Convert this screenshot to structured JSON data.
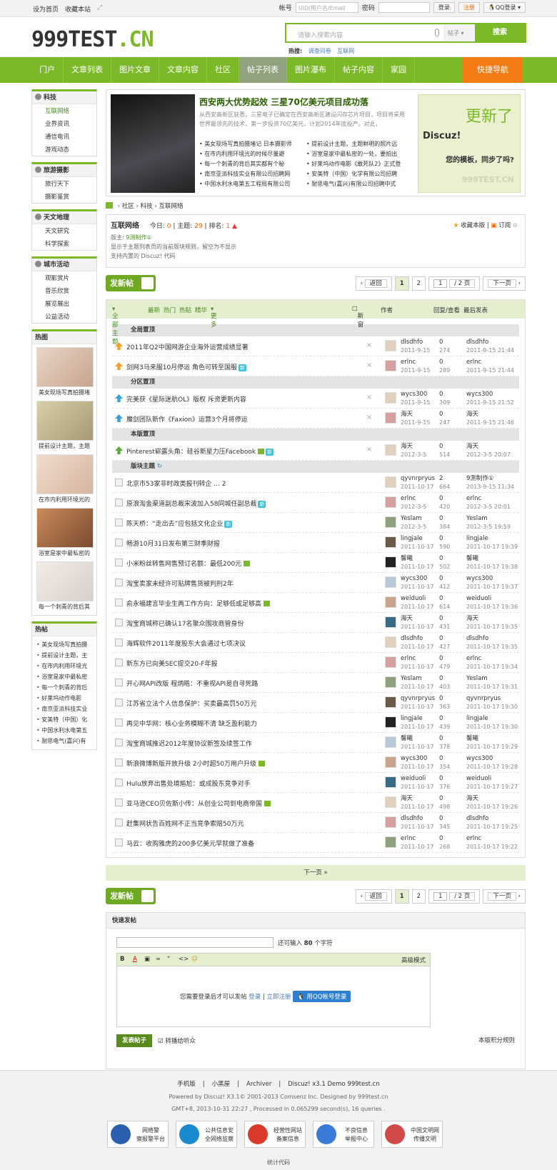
{
  "topbar": {
    "left": [
      "设为首页",
      "收藏本站"
    ],
    "account_label": "帐号",
    "account_placeholder": "UID/用户名/Email",
    "pwd_label": "密码",
    "login": "登录",
    "register": "注册",
    "qq": "QQ登录"
  },
  "header": {
    "logo_main": "999TEST",
    "logo_cn": ".CN",
    "search_placeholder": "请输入搜索内容",
    "search_type": "帖子",
    "search_btn": "搜索",
    "hot_label": "热搜:",
    "hot_items": [
      "调查问卷",
      "互联网"
    ]
  },
  "nav": {
    "items": [
      "门户",
      "文章列表",
      "图片文章",
      "文章内容",
      "社区",
      "帖子列表",
      "图片瀑布",
      "帖子内容",
      "家园"
    ],
    "active": "帖子列表",
    "quick": "快捷导航"
  },
  "sidebar": {
    "groups": [
      {
        "title": "科技",
        "items": [
          "互联网络",
          "业界资讯",
          "通信电讯",
          "游戏动态"
        ]
      },
      {
        "title": "旅游摄影",
        "items": [
          "旅行天下",
          "摄影鉴赏"
        ]
      },
      {
        "title": "天文地理",
        "items": [
          "天文研究",
          "科学探索"
        ]
      },
      {
        "title": "城市活动",
        "items": [
          "观影赏片",
          "音乐欣赏",
          "展览展出",
          "公益活动"
        ]
      }
    ],
    "hotpic_title": "热图",
    "hotpics": [
      "美女现场写真拍摄堵",
      "提前设计主题，主题",
      "在市内利用环境光的",
      "浴室是家中最私密的",
      "每一个刺青的背后其"
    ],
    "hotpost_title": "热帖",
    "hotposts": [
      "美女现场写真拍摄",
      "提前设计主题，主",
      "在市内利用环境光",
      "浴室是家中最私密",
      "每一个刺青的背后",
      "好莱坞动作电影",
      "南京亚派科技实业",
      "安美特（中国）化",
      "中国水利水电第五",
      "耐思电气(嘉兴)有"
    ]
  },
  "feature": {
    "title": "西安两大优势起效 三星70亿美元项目成功落",
    "desc": "从西安高新区获悉，三星电子已确定在西安高新区建设闪存芯片项目，项目将采用世界最领先的技术，第一步投资70亿美元，计划2014年底投产。对此，",
    "links": [
      "美女现场写真拍摄堵记 日本摄影师",
      "提前设计主题，主题鲜明的照片远",
      "在市内利用环境光的时候尽量避",
      "浴室是家中最私密的一处，要拍出",
      "每一个刺青的背后其实都有个秘",
      "好莱坞动作电影《敢死队2》正式登",
      "南京亚派科技实业有限公司招聘网",
      "安美特（中国）化学有限公司招聘",
      "中国水利水电第五工程局有限公司",
      "耐思电气(嘉兴)有限公司招聘中式"
    ],
    "ad1": "更新了",
    "ad2": "Discuz!",
    "ad3": "您的模板，同步了吗?",
    "ad4": "999TEST.CN"
  },
  "breadcrumb": [
    "社区",
    "科技",
    "互联网络"
  ],
  "forum": {
    "name": "互联网络",
    "today_label": "今日:",
    "today": "0",
    "topics_label": "主题:",
    "topics": "29",
    "rank_label": "排名:",
    "rank": "1",
    "fav": "收藏本版",
    "rss": "订阅",
    "mod_label": "版主:",
    "mod": "9测制作①",
    "rule1": "显示于主题列表页的当前版块规则，留空为不显示",
    "rule2": "支持内置的 Discuz! 代码"
  },
  "pager": {
    "post": "发新帖",
    "back": "返回",
    "p1": "1",
    "p2": "2",
    "cur": "1",
    "total": "/ 2 页",
    "next": "下一页"
  },
  "listhead": {
    "all": "全部主题",
    "latest": "最新",
    "hot": "热门",
    "hotpost": "热贴",
    "digest": "精华",
    "more": "更多",
    "newwin": "新窗",
    "author": "作者",
    "reply": "回复/查看",
    "last": "最后发表"
  },
  "sections": {
    "global": "全局置顶",
    "cat": "分区置顶",
    "forum": "本版置顶",
    "topics": "版块主题"
  },
  "global_rows": [
    {
      "title": "2011年Q2中国网游企业海外运营成绩显著",
      "author": "dlsdhfo",
      "date": "2011-9-15",
      "r": "0",
      "v": "274",
      "lu": "dlsdhfo",
      "ld": "2011-9-15 21:44",
      "new": false
    },
    {
      "title": "剑网3马来服10月停运 角色可转至国服",
      "author": "erlnc",
      "date": "2011-9-15",
      "r": "0",
      "v": "289",
      "lu": "erlnc",
      "ld": "2011-9-15 21:44",
      "new": true
    }
  ],
  "cat_rows": [
    {
      "title": "完美获《星际迷航OL》版权 斥资更新内容",
      "author": "wycs300",
      "date": "2011-9-15",
      "r": "0",
      "v": "309",
      "lu": "wycs300",
      "ld": "2011-9-15 21:52",
      "new": false
    },
    {
      "title": "魔剑团队新作《Faxion》运营3个月将停运",
      "author": "海天",
      "date": "2011-9-15",
      "r": "0",
      "v": "247",
      "lu": "海天",
      "ld": "2011-9-15 21:46",
      "new": false
    }
  ],
  "forum_rows": [
    {
      "title": "Pinterest崭露头角：硅谷新星力压Facebook",
      "author": "海天",
      "date": "2012-3-5",
      "r": "0",
      "v": "514",
      "lu": "海天",
      "ld": "2012-3-5 20:07",
      "new": true,
      "img": true
    }
  ],
  "rows": [
    {
      "title": "北京市53家非时政类报刊转企",
      "suffix": " ... 2",
      "author": "qyvnrpryus",
      "date": "2011-10-17",
      "r": "2",
      "v": "664",
      "lu": "9测制作①",
      "ld": "2013-9-15 11:34"
    },
    {
      "title": "原浪淘金渠道副总裁宋波加入58同城任副总裁",
      "author": "erlnc",
      "date": "2012-3-5",
      "r": "0",
      "v": "420",
      "lu": "erlnc",
      "ld": "2012-3-5 20:01",
      "new": true
    },
    {
      "title": "陈天桥：“走出去”应包括文化企业",
      "author": "Yeslam",
      "date": "2012-3-5",
      "r": "0",
      "v": "384",
      "lu": "Yeslam",
      "ld": "2012-3-5 19:59",
      "new": true
    },
    {
      "title": "畅游10月31日发布第三财季财报",
      "author": "lingjale",
      "date": "2011-10-17",
      "r": "0",
      "v": "590",
      "lu": "lingjale",
      "ld": "2011-10-17 19:39"
    },
    {
      "title": "小米粉丝转售网售预订名额：最低200元",
      "author": "馨曦",
      "date": "2011-10-17",
      "r": "0",
      "v": "502",
      "lu": "馨曦",
      "ld": "2011-10-17 19:38",
      "img": true
    },
    {
      "title": "淘宝卖家未经许可贴牌售货被判刑2年",
      "author": "wycs300",
      "date": "2011-10-17",
      "r": "0",
      "v": "412",
      "lu": "wycs300",
      "ld": "2011-10-17 19:37"
    },
    {
      "title": "俞永福建言毕业生两工作方向：足够低或足够高",
      "author": "weiduoli",
      "date": "2011-10-17",
      "r": "0",
      "v": "614",
      "lu": "weiduoli",
      "ld": "2011-10-17 19:36",
      "img": true
    },
    {
      "title": "淘宝商城称已确认17名聚众围攻商管身份",
      "author": "海天",
      "date": "2011-10-17",
      "r": "0",
      "v": "431",
      "lu": "海天",
      "ld": "2011-10-17 19:35"
    },
    {
      "title": "海辉软件2011年度股东大会通过七项决议",
      "author": "dlsdhfo",
      "date": "2011-10-17",
      "r": "0",
      "v": "427",
      "lu": "dlsdhfo",
      "ld": "2011-10-17 19:35"
    },
    {
      "title": "新东方已向美SEC提交20-F年报",
      "author": "erlnc",
      "date": "2011-10-17",
      "r": "0",
      "v": "479",
      "lu": "erlnc",
      "ld": "2011-10-17 19:34"
    },
    {
      "title": "开心网API改版 程炳皓：不重视API是自寻死路",
      "author": "Yeslam",
      "date": "2011-10-17",
      "r": "0",
      "v": "403",
      "lu": "Yeslam",
      "ld": "2011-10-17 19:31"
    },
    {
      "title": "江苏省立法个人信息保护：买卖最高罚50万元",
      "author": "qyvnrpryus",
      "date": "2011-10-17",
      "r": "0",
      "v": "363",
      "lu": "qyvnrpryus",
      "ld": "2011-10-17 19:30"
    },
    {
      "title": "再见中华网：核心业务模糊不清 缺乏盈利能力",
      "author": "lingjale",
      "date": "2011-10-17",
      "r": "0",
      "v": "439",
      "lu": "lingjale",
      "ld": "2011-10-17 19:30"
    },
    {
      "title": "淘宝商城推迟2012年度协议新签及续签工作",
      "author": "馨曦",
      "date": "2011-10-17",
      "r": "0",
      "v": "378",
      "lu": "馨曦",
      "ld": "2011-10-17 19:29"
    },
    {
      "title": "新浪微博新版开放升级 2小时超50万用户升级",
      "author": "wycs300",
      "date": "2011-10-17",
      "r": "0",
      "v": "354",
      "lu": "wycs300",
      "ld": "2011-10-17 19:28",
      "img": true
    },
    {
      "title": "Hulu放弃出售处境尴尬：或成股东竞争对手",
      "author": "weiduoli",
      "date": "2011-10-17",
      "r": "0",
      "v": "376",
      "lu": "weiduoli",
      "ld": "2011-10-17 19:27"
    },
    {
      "title": "亚马逊CEO贝佐斯小传：从创业公司到电商帝国",
      "author": "海天",
      "date": "2011-10-17",
      "r": "0",
      "v": "498",
      "lu": "海天",
      "ld": "2011-10-17 19:26",
      "img": true
    },
    {
      "title": "赶集网状告百姓网不正当竞争索赔50万元",
      "author": "dlsdhfo",
      "date": "2011-10-17",
      "r": "0",
      "v": "345",
      "lu": "dlsdhfo",
      "ld": "2011-10-17 19:25"
    },
    {
      "title": "马云：收购雅虎的200多亿美元早就做了准备",
      "author": "erlnc",
      "date": "2011-10-17",
      "r": "0",
      "v": "268",
      "lu": "erlnc",
      "ld": "2011-10-17 19:22"
    }
  ],
  "next_page": "下一页 »",
  "quickpost": {
    "title": "快速发帖",
    "remain": "还可输入",
    "num": "80",
    "unit": "个字符",
    "advanced": "高级模式",
    "need": "您需要登录后才可以发帖",
    "login": "登录",
    "reg": "立即注册",
    "qq": "用QQ帐号登录",
    "send": "发表帖子",
    "weibo": "转播给听众",
    "rule": "本版积分规则"
  },
  "footer": {
    "links": [
      "手机版",
      "小黑屋",
      "Archiver",
      "Discuz! x3.1 Demo 999test.cn"
    ],
    "powered": "Powered by Discuz! X3.1© 2001-2013 Comsenz Inc. Designed by 999test.cn",
    "time": "GMT+8, 2013-10-31 22:27 , Processed in 0.065299 second(s), 16 queries .",
    "badges": [
      [
        "网络警",
        "察报警平台"
      ],
      [
        "公共信息安",
        "全网络监察"
      ],
      [
        "经营性网站",
        "备案信息"
      ],
      [
        "不良信息",
        "举报中心"
      ],
      [
        "中国文明网",
        "传播文明"
      ]
    ],
    "stat": "统计代码"
  }
}
